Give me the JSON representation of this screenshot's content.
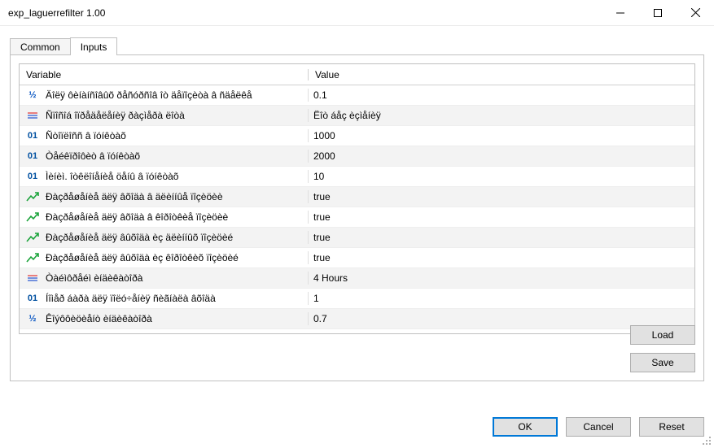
{
  "window": {
    "title": "exp_laguerrefilter 1.00"
  },
  "tabs": {
    "common": "Common",
    "inputs": "Inputs",
    "active": "inputs"
  },
  "table": {
    "headers": {
      "variable": "Variable",
      "value": "Value"
    },
    "rows": [
      {
        "type": "half",
        "name": "Äîëÿ ôèíàíñîâûõ ðåñóðñîâ îò äåïîçèòà â ñäåëêå",
        "value": "0.1"
      },
      {
        "type": "str",
        "name": "Ñïîñîá îïðåäåëåíèÿ ðàçìåðà ëîòà",
        "value": "Ëîò áåç èçìåíèÿ"
      },
      {
        "type": "int",
        "name": "Ñòîïëîññ â ïóíêòàõ",
        "value": "1000"
      },
      {
        "type": "int",
        "name": "Òåéêïðîôèò â ïóíêòàõ",
        "value": "2000"
      },
      {
        "type": "int",
        "name": "Ìèíèì. îòêëîíåíèå öåíû â ïóíêòàõ",
        "value": "10"
      },
      {
        "type": "arrow",
        "name": "Ðàçðåøåíèå äëÿ âõîäà â äëèííûå ïîçèöèè",
        "value": "true"
      },
      {
        "type": "arrow",
        "name": "Ðàçðåøåíèå äëÿ âõîäà â êîðîòêèå ïîçèöèè",
        "value": "true"
      },
      {
        "type": "arrow",
        "name": "Ðàçðåøåíèå äëÿ âûõîäà èç äëèííûõ ïîçèöèé",
        "value": "true"
      },
      {
        "type": "arrow",
        "name": "Ðàçðåøåíèå äëÿ âûõîäà èç êîðîòêèõ ïîçèöèé",
        "value": "true"
      },
      {
        "type": "str",
        "name": "Òàéìôðåéì èíäèêàòîðà",
        "value": "4 Hours"
      },
      {
        "type": "int",
        "name": "Íîìåð áàðà äëÿ ïîëó÷åíèÿ ñèãíàëà âõîäà",
        "value": "1"
      },
      {
        "type": "half",
        "name": "Êîýôôèöèåíò èíäèêàòîðà",
        "value": "0.7"
      }
    ]
  },
  "buttons": {
    "load": "Load",
    "save": "Save",
    "ok": "OK",
    "cancel": "Cancel",
    "reset": "Reset"
  }
}
